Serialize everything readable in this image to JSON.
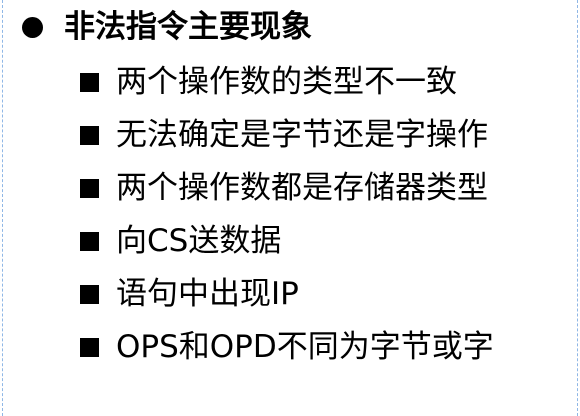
{
  "heading": {
    "bullet_icon": "filled-circle-icon",
    "text": "非法指令主要现象"
  },
  "items": [
    {
      "bullet_icon": "filled-square-icon",
      "text": "两个操作数的类型不一致"
    },
    {
      "bullet_icon": "filled-square-icon",
      "text": "无法确定是字节还是字操作"
    },
    {
      "bullet_icon": "filled-square-icon",
      "text": "两个操作数都是存储器类型"
    },
    {
      "bullet_icon": "filled-square-icon",
      "text": "向CS送数据"
    },
    {
      "bullet_icon": "filled-square-icon",
      "text": "语句中出现IP"
    },
    {
      "bullet_icon": "filled-square-icon",
      "text": "OPS和OPD不同为字节或字"
    }
  ],
  "colors": {
    "text": "#000000",
    "background": "#ffffff",
    "frame_border": "#8fb7e6"
  }
}
